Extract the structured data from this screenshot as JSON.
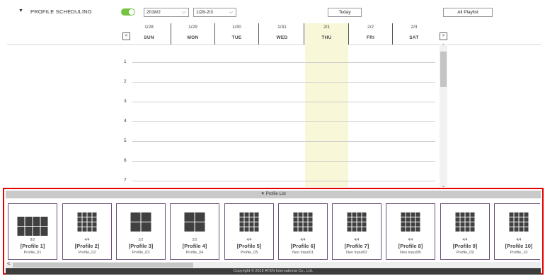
{
  "section": {
    "arrow": "▼",
    "title": "PROFILE SCHEDULING"
  },
  "controls": {
    "month_value": "2018/2",
    "week_value": "1/28-2/3",
    "chev": "⌵",
    "today_label": "Today",
    "all_playlist_label": "All Playlist"
  },
  "week": {
    "prev": "<",
    "next": ">",
    "days": [
      {
        "date": "1/28",
        "name": "SUN"
      },
      {
        "date": "1/29",
        "name": "MON"
      },
      {
        "date": "1/30",
        "name": "TUE"
      },
      {
        "date": "1/31",
        "name": "WED"
      },
      {
        "date": "2/1",
        "name": "THU"
      },
      {
        "date": "2/2",
        "name": "FRI"
      },
      {
        "date": "2/3",
        "name": "SAT"
      }
    ]
  },
  "slots": [
    "1",
    "2",
    "3",
    "4",
    "5",
    "6",
    "7"
  ],
  "scroll": {
    "up": "⌃",
    "down": "⌄"
  },
  "profile_list": {
    "header": "▼ Profile List",
    "profiles": [
      {
        "ratio": "8/2",
        "name": "[Profile 1]",
        "sub": "Profile_01",
        "layout": "4x2"
      },
      {
        "ratio": "4/4",
        "name": "[Profile 2]",
        "sub": "Profile_02",
        "layout": "4x4"
      },
      {
        "ratio": "2/2",
        "name": "[Profile 3]",
        "sub": "Profile_03",
        "layout": "2x2"
      },
      {
        "ratio": "2/2",
        "name": "[Profile 4]",
        "sub": "Profile_04",
        "layout": "2x2"
      },
      {
        "ratio": "4/4",
        "name": "[Profile 5]",
        "sub": "Profile_05",
        "layout": "4x4"
      },
      {
        "ratio": "4/4",
        "name": "[Profile 6]",
        "sub": "Neo Input01",
        "layout": "4x4"
      },
      {
        "ratio": "4/4",
        "name": "[Profile 7]",
        "sub": "Neo Input02",
        "layout": "4x4"
      },
      {
        "ratio": "4/4",
        "name": "[Profile 8]",
        "sub": "Neo Input05",
        "layout": "4x4"
      },
      {
        "ratio": "4/4",
        "name": "[Profile 9]",
        "sub": "Profile_09",
        "layout": "4x4"
      },
      {
        "ratio": "4/4",
        "name": "[Profile 10]",
        "sub": "Profile_10",
        "layout": "4x4"
      }
    ],
    "scroll_left": "<"
  },
  "footer": {
    "copyright": "Copyright © 2016 ATEN International Co., Ltd."
  },
  "colors": {
    "toggle_on": "#74c43d",
    "today_highlight": "#f8f7d8",
    "panel_border": "#e30000",
    "card_border": "#6a4f7a"
  }
}
